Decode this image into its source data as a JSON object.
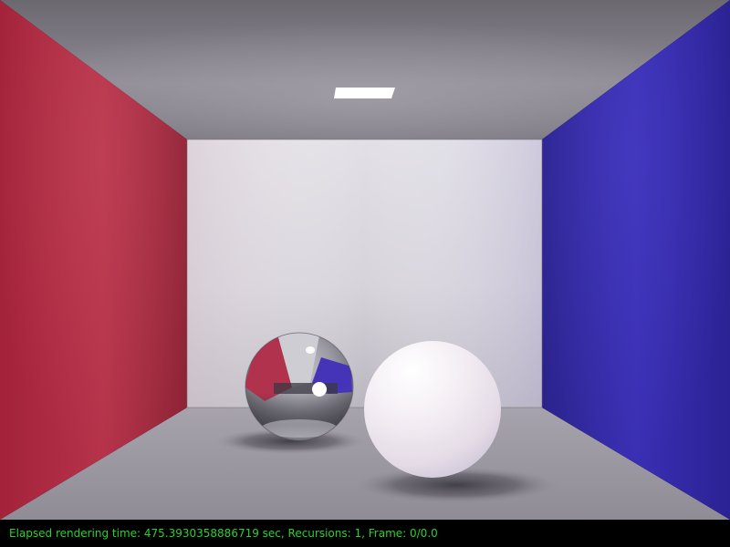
{
  "scene": {
    "colors": {
      "left_wall": "#b12a3e",
      "right_wall": "#3a2eb0",
      "back_wall": "#d8d6de",
      "ceiling": "#8d8a93",
      "floor": "#a29fa8",
      "light": "#ffffff",
      "diffuse_sphere": "#f2eaf2",
      "mirror_sphere_base": "#8e8c94"
    },
    "objects": [
      "ceiling-light",
      "mirror-sphere",
      "diffuse-sphere"
    ]
  },
  "status": {
    "text": "Elapsed rendering time: 475.3930358886719 sec, Recursions: 1, Frame: 0/0.0",
    "color": "#2ecf2e"
  }
}
